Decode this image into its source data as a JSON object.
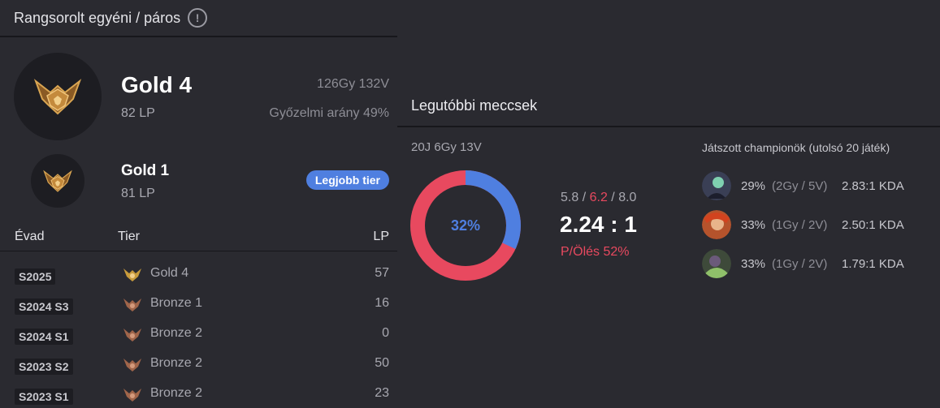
{
  "ranked": {
    "header_title": "Rangsorolt egyéni / páros",
    "info_icon": "!",
    "current": {
      "rank": "Gold 4",
      "lp": "82 LP",
      "wins_losses": "126Gy 132V",
      "winrate": "Győzelmi arány 49%"
    },
    "best": {
      "rank": "Gold 1",
      "lp": "81 LP",
      "badge": "Legjobb tier"
    },
    "seasons_header": {
      "season": "Évad",
      "tier": "Tier",
      "lp": "LP"
    },
    "seasons": [
      {
        "season": "S2025",
        "tier": "Gold 4",
        "lp": "57",
        "tier_color": "#c89b3c"
      },
      {
        "season": "S2024 S3",
        "tier": "Bronze 1",
        "lp": "16",
        "tier_color": "#a0654a"
      },
      {
        "season": "S2024 S1",
        "tier": "Bronze 2",
        "lp": "0",
        "tier_color": "#a0654a"
      },
      {
        "season": "S2023 S2",
        "tier": "Bronze 2",
        "lp": "50",
        "tier_color": "#a0654a"
      },
      {
        "season": "S2023 S1",
        "tier": "Bronze 2",
        "lp": "23",
        "tier_color": "#a0654a"
      }
    ]
  },
  "recent": {
    "title": "Legutóbbi meccsek",
    "summary": "20J 6Gy 13V",
    "winrate_fraction": 0.32,
    "winrate_label": "32%",
    "kills": "5.8",
    "deaths": "6.2",
    "assists": "8.0",
    "separator": " / ",
    "kda_ratio": "2.24 : 1",
    "kill_participation": "P/Ölés 52%",
    "champions_title": "Játszott championök (utolsó 20 játék)",
    "champions": [
      {
        "pct": "29%",
        "wl": "(2Gy / 5V)",
        "kda": "2.83:1 KDA",
        "avatar_color": "#3a3f55",
        "accent": "#7fd0b0"
      },
      {
        "pct": "33%",
        "wl": "(1Gy / 2V)",
        "kda": "2.50:1 KDA",
        "avatar_color": "#b5532c",
        "accent": "#e8b48a"
      },
      {
        "pct": "33%",
        "wl": "(1Gy / 2V)",
        "kda": "1.79:1 KDA",
        "avatar_color": "#3e4a3a",
        "accent": "#8fc06a"
      }
    ]
  },
  "colors": {
    "win": "#4f7fe0",
    "loss": "#e8495f",
    "gold": "#c89b3c",
    "bronze": "#a0654a"
  }
}
